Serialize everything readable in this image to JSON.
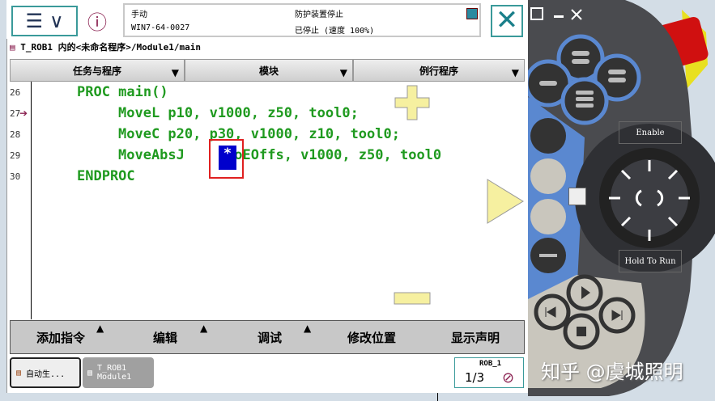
{
  "header": {
    "mode": "手动",
    "system": "WIN7-64-0027",
    "guard": "防护装置停止",
    "state": "已停止 (速度 100%)"
  },
  "path": "T_ROB1 内的<未命名程序>/Module1/main",
  "dropdowns": [
    "任务与程序",
    "模块",
    "例行程序"
  ],
  "code": [
    {
      "n": "26",
      "text": "PROC main()",
      "indent": 1
    },
    {
      "n": "27",
      "text": "MoveL p10, v1000, z50, tool0;",
      "indent": 2
    },
    {
      "n": "28",
      "text": "MoveC p20, p30, v1000, z10, tool0;",
      "indent": 2
    },
    {
      "n": "29",
      "text": "MoveAbsJ    \\NoEOffs, v1000, z50, tool0",
      "indent": 2
    },
    {
      "n": "30",
      "text": "ENDPROC",
      "indent": 1
    }
  ],
  "selected_token": "*",
  "bottom_menu": [
    "添加指令",
    "编辑",
    "调试",
    "修改位置",
    "显示声明"
  ],
  "taskbar": {
    "item1": "自动生...",
    "item2_line1": "T_ROB1",
    "item2_line2": "Module1",
    "rob": "ROB_1",
    "fraction": "1/3"
  },
  "pendant": {
    "enable": "Enable",
    "hold": "Hold To Run"
  },
  "watermark": "知乎 @虞城照明",
  "colors": {
    "code": "#1f9a1f",
    "accent": "#3a9a9a",
    "selection": "#0000cc",
    "highlight": "#e02020"
  }
}
